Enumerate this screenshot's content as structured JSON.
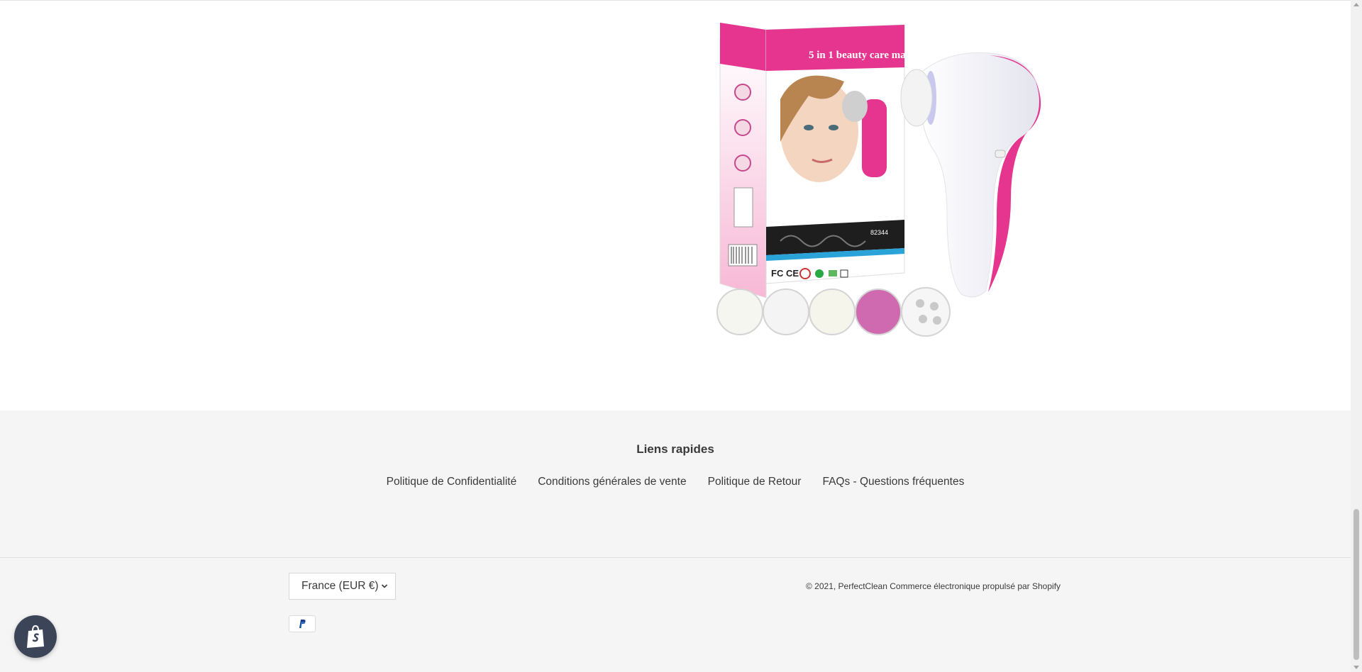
{
  "product": {
    "image_alt": "5 in 1 beauty care massager",
    "box_text": "5 in 1 beauty care massager",
    "box_model": "82344",
    "box_marks": "FC CE"
  },
  "footer": {
    "quick_links_title": "Liens rapides",
    "links": [
      "Politique de Confidentialité",
      "Conditions générales de vente",
      "Politique de Retour",
      "FAQs - Questions fréquentes"
    ],
    "currency": "France (EUR €)",
    "copyright": "© 2021, PerfectClean Commerce électronique propulsé par Shopify",
    "payment_icon": "paypal-icon"
  },
  "colors": {
    "footer_bg": "#f5f5f5",
    "product_pink": "#e8338e",
    "shop_button": "#3c4557"
  }
}
